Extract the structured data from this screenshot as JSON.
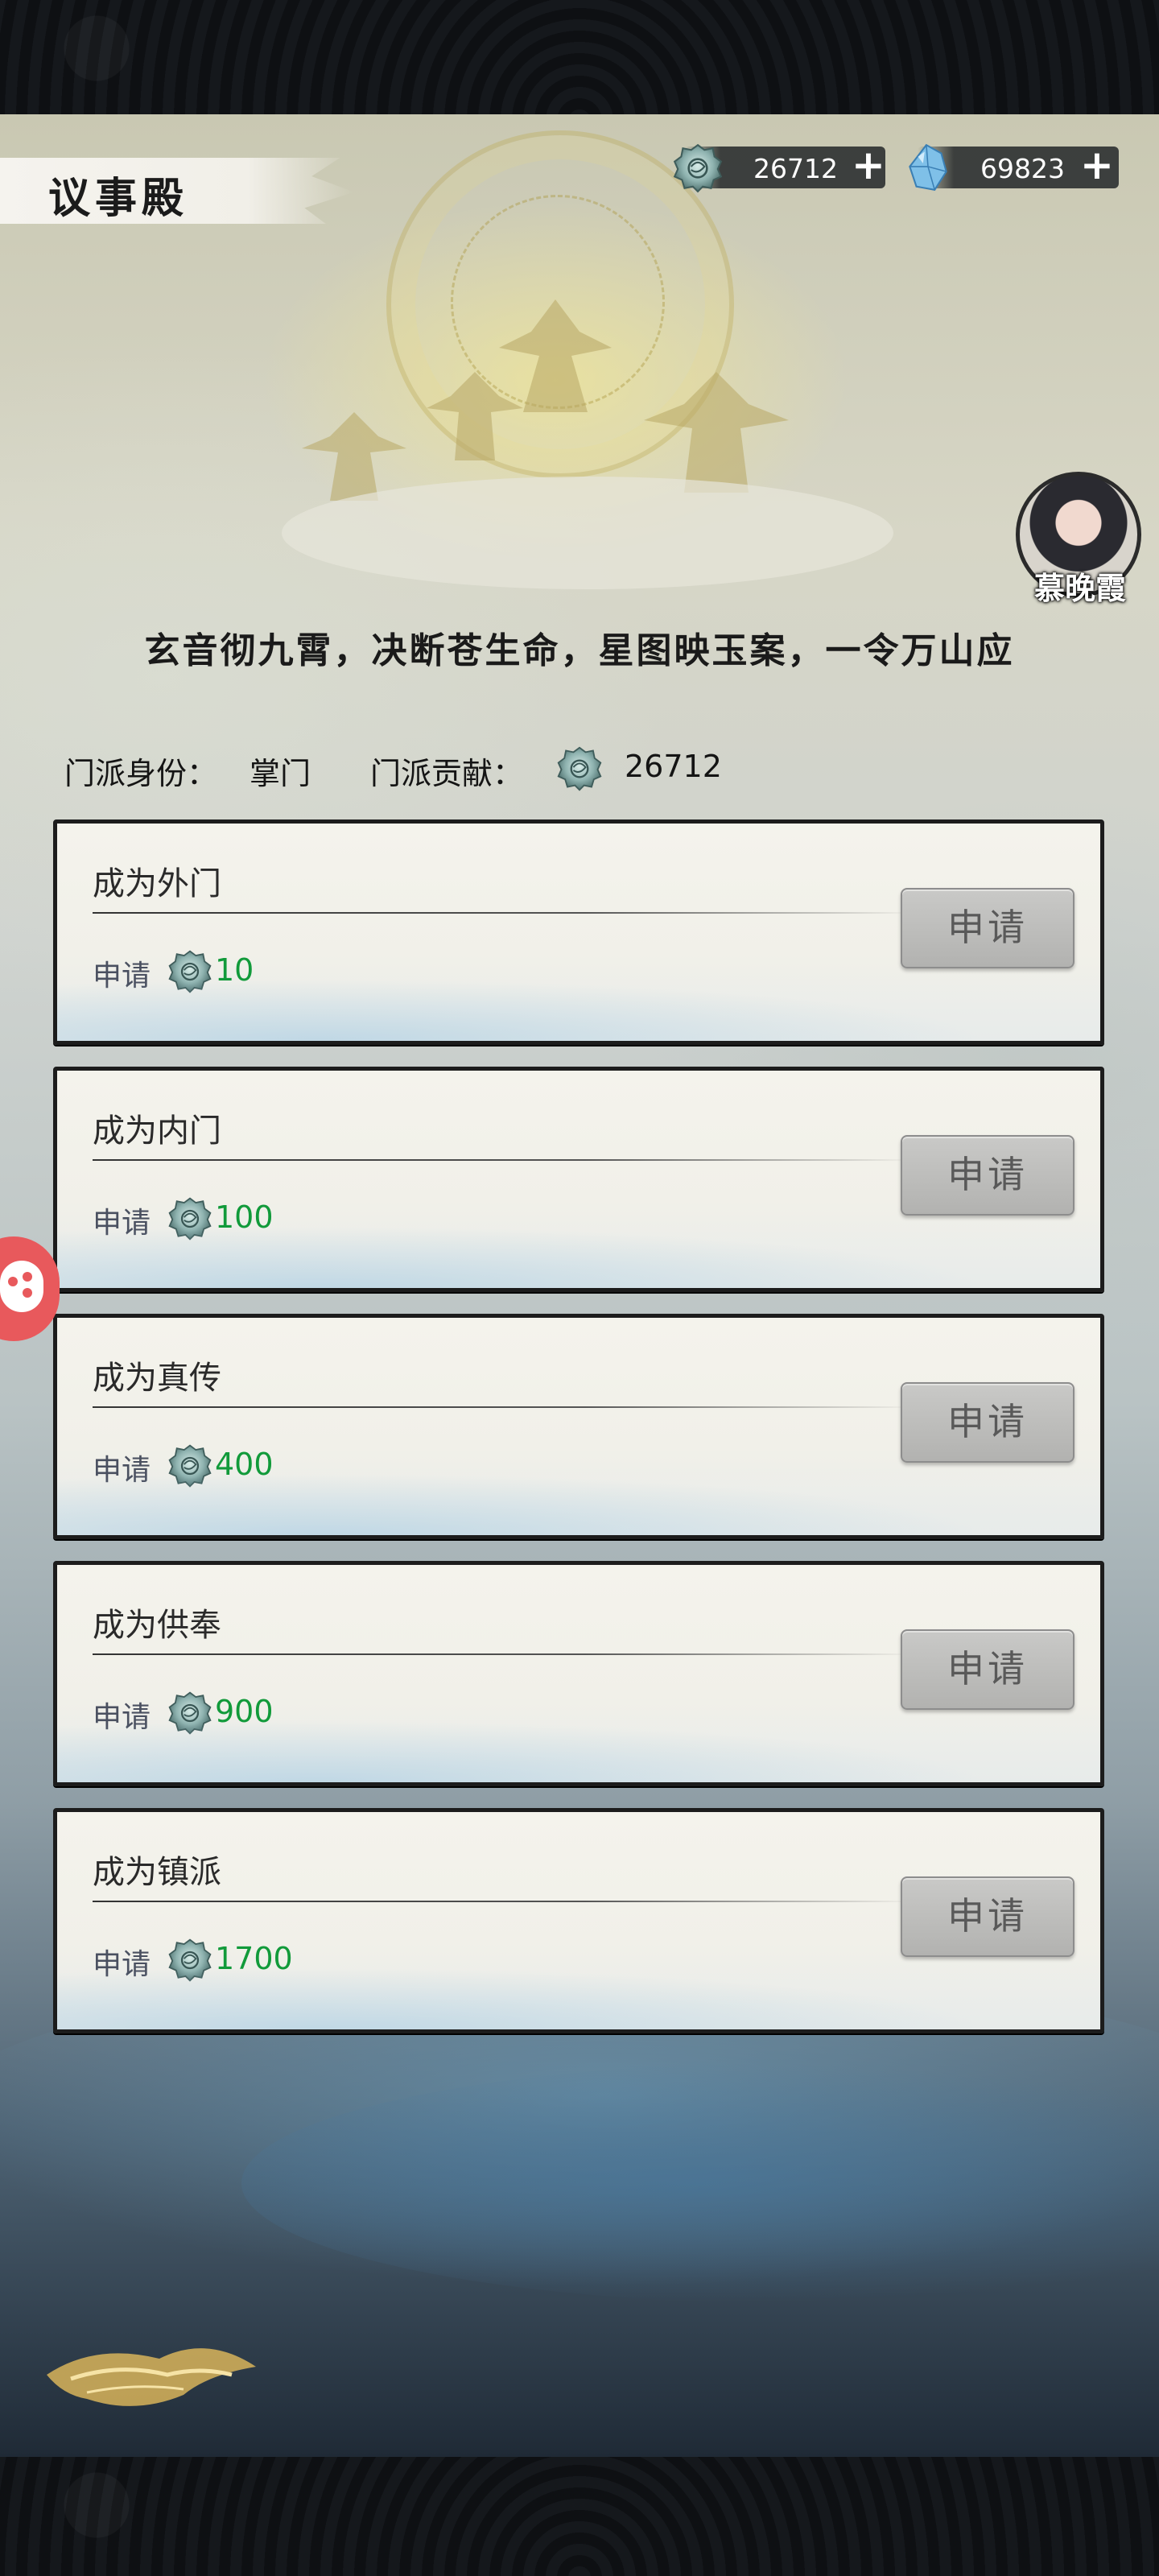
{
  "header": {
    "title": "议事殿",
    "currencies": [
      {
        "icon": "jade-token-icon",
        "value": "26712",
        "plus": "+"
      },
      {
        "icon": "blue-crystal-icon",
        "value": "69823",
        "plus": "+"
      }
    ]
  },
  "npc": {
    "name": "慕晚霞"
  },
  "poem": "玄音彻九霄，决断苍生命，星图映玉案，一令万山应",
  "status": {
    "identity_label": "门派身份：",
    "identity_value": "掌门",
    "contribution_label": "门派贡献：",
    "contribution_value": "26712"
  },
  "ranks": [
    {
      "title": "成为外门",
      "request_label": "申请",
      "cost": "10",
      "button": "申请"
    },
    {
      "title": "成为内门",
      "request_label": "申请",
      "cost": "100",
      "button": "申请"
    },
    {
      "title": "成为真传",
      "request_label": "申请",
      "cost": "400",
      "button": "申请"
    },
    {
      "title": "成为供奉",
      "request_label": "申请",
      "cost": "900",
      "button": "申请"
    },
    {
      "title": "成为镇派",
      "request_label": "申请",
      "cost": "1700",
      "button": "申请"
    }
  ],
  "colors": {
    "cost_green": "#119a3a",
    "button_gray": "#b8b8b6",
    "float_red": "#e8595c"
  }
}
